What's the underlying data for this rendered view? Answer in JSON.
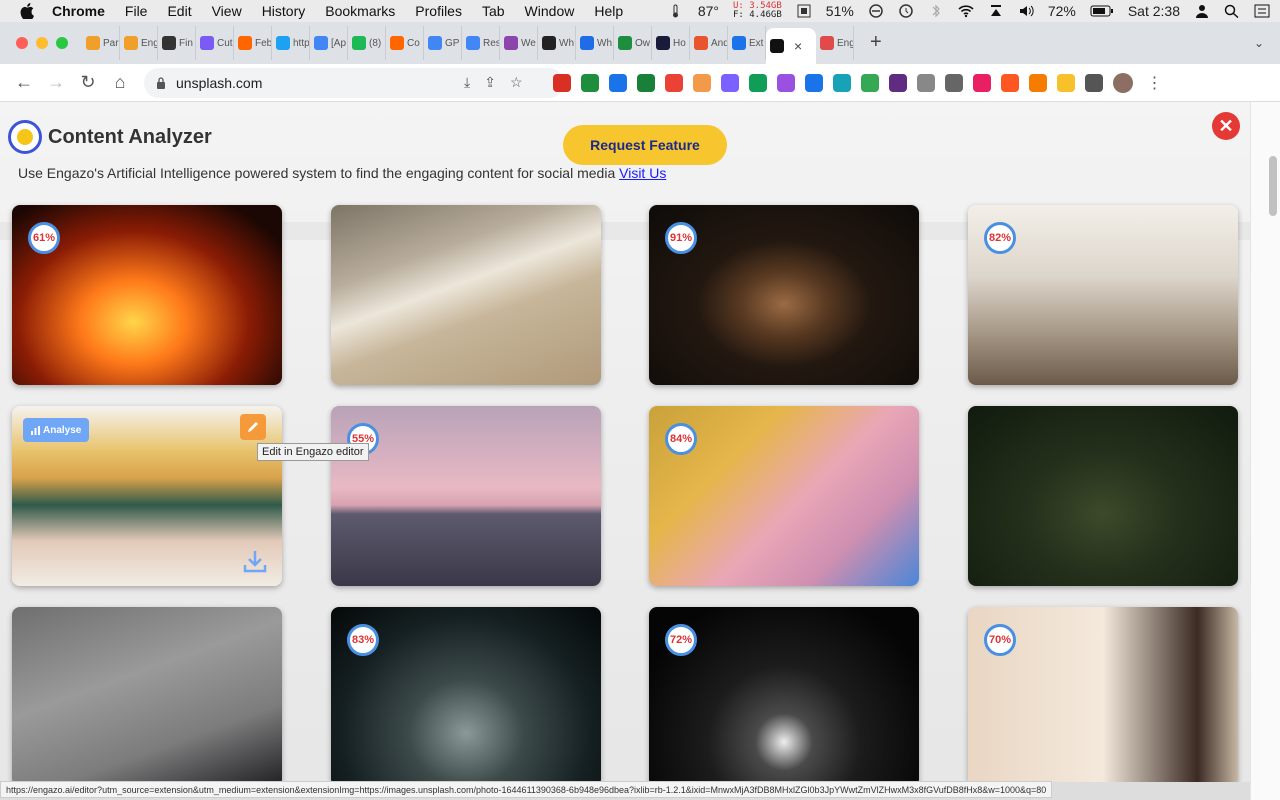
{
  "menubar": {
    "app": "Chrome",
    "items": [
      "File",
      "Edit",
      "View",
      "History",
      "Bookmarks",
      "Profiles",
      "Tab",
      "Window",
      "Help"
    ],
    "temp": "87°",
    "mem_u": "U: 3.54GB",
    "mem_f": "F: 4.46GB",
    "cpu": "51%",
    "battery": "72%",
    "clock": "Sat 2:38"
  },
  "tabs": [
    {
      "label": "Par",
      "color": "#f0a02a"
    },
    {
      "label": "Eng",
      "color": "#f0a02a"
    },
    {
      "label": "Fin",
      "color": "#333333"
    },
    {
      "label": "Cut",
      "color": "#7a5af5"
    },
    {
      "label": "Feb",
      "color": "#ff6600"
    },
    {
      "label": "http",
      "color": "#1da1f2"
    },
    {
      "label": "[Ap",
      "color": "#4285f4"
    },
    {
      "label": "(8)",
      "color": "#1db954"
    },
    {
      "label": "Co",
      "color": "#ff6600"
    },
    {
      "label": "GP",
      "color": "#4285f4"
    },
    {
      "label": "Res",
      "color": "#4285f4"
    },
    {
      "label": "We",
      "color": "#8e44ad"
    },
    {
      "label": "Wh",
      "color": "#222222"
    },
    {
      "label": "Wh",
      "color": "#1e6ce8"
    },
    {
      "label": "Ow",
      "color": "#1e8e3e"
    },
    {
      "label": "Ho",
      "color": "#1a1a3a"
    },
    {
      "label": "And",
      "color": "#e8542c"
    },
    {
      "label": "Ext",
      "color": "#1a73e8"
    },
    {
      "label": "",
      "color": "#111111",
      "active": true
    },
    {
      "label": "Eng",
      "color": "#e04a4a"
    }
  ],
  "address": {
    "url": "unsplash.com"
  },
  "extensions": [
    "#d93025",
    "#1e8e3e",
    "#1a73e8",
    "#188038",
    "#ea4335",
    "#f2994a",
    "#7b61ff",
    "#0f9d58",
    "#9b51e0",
    "#1a73e8",
    "#17a2b8",
    "#34a853",
    "#5f2c82",
    "#888888",
    "#666666",
    "#e91e63",
    "#ff5722",
    "#f57c00",
    "#f6c12b",
    "#555555"
  ],
  "analyzer": {
    "title": "Content Analyzer",
    "request_button": "Request Feature",
    "close": "✕",
    "subtitle": "Use Engazo's Artificial Intelligence powered system to find the engaging content for social media",
    "visit_link": "Visit Us",
    "analyse_label": "Analyse",
    "edit_tooltip": "Edit in Engazo editor"
  },
  "cards": [
    {
      "score": "61%",
      "desc": "blurred car at night"
    },
    {
      "score": "",
      "desc": "ocean wave on sand"
    },
    {
      "score": "91%",
      "desc": "bowl of coffee beans"
    },
    {
      "score": "82%",
      "desc": "family with laptop"
    },
    {
      "score": "",
      "desc": "knitted sweaters stack",
      "hovered": true
    },
    {
      "score": "55%",
      "desc": "pink sunset over sea"
    },
    {
      "score": "84%",
      "desc": "bitcoin stairs illustration"
    },
    {
      "score": "",
      "desc": "girl in forest"
    },
    {
      "score": "",
      "desc": "sneakers on asphalt"
    },
    {
      "score": "83%",
      "desc": "subway escalator"
    },
    {
      "score": "72%",
      "desc": "dark cave"
    },
    {
      "score": "70%",
      "desc": "woman by window"
    }
  ],
  "status_url": "https://engazo.ai/editor?utm_source=extension&utm_medium=extension&extensionImg=https://images.unsplash.com/photo-1644611390368-6b948e96dbea?ixlib=rb-1.2.1&ixid=MnwxMjA3fDB8MHxlZGl0b3JpYWwtZmVlZHwxM3x8fGVufDB8fHx8&w=1000&q=80"
}
